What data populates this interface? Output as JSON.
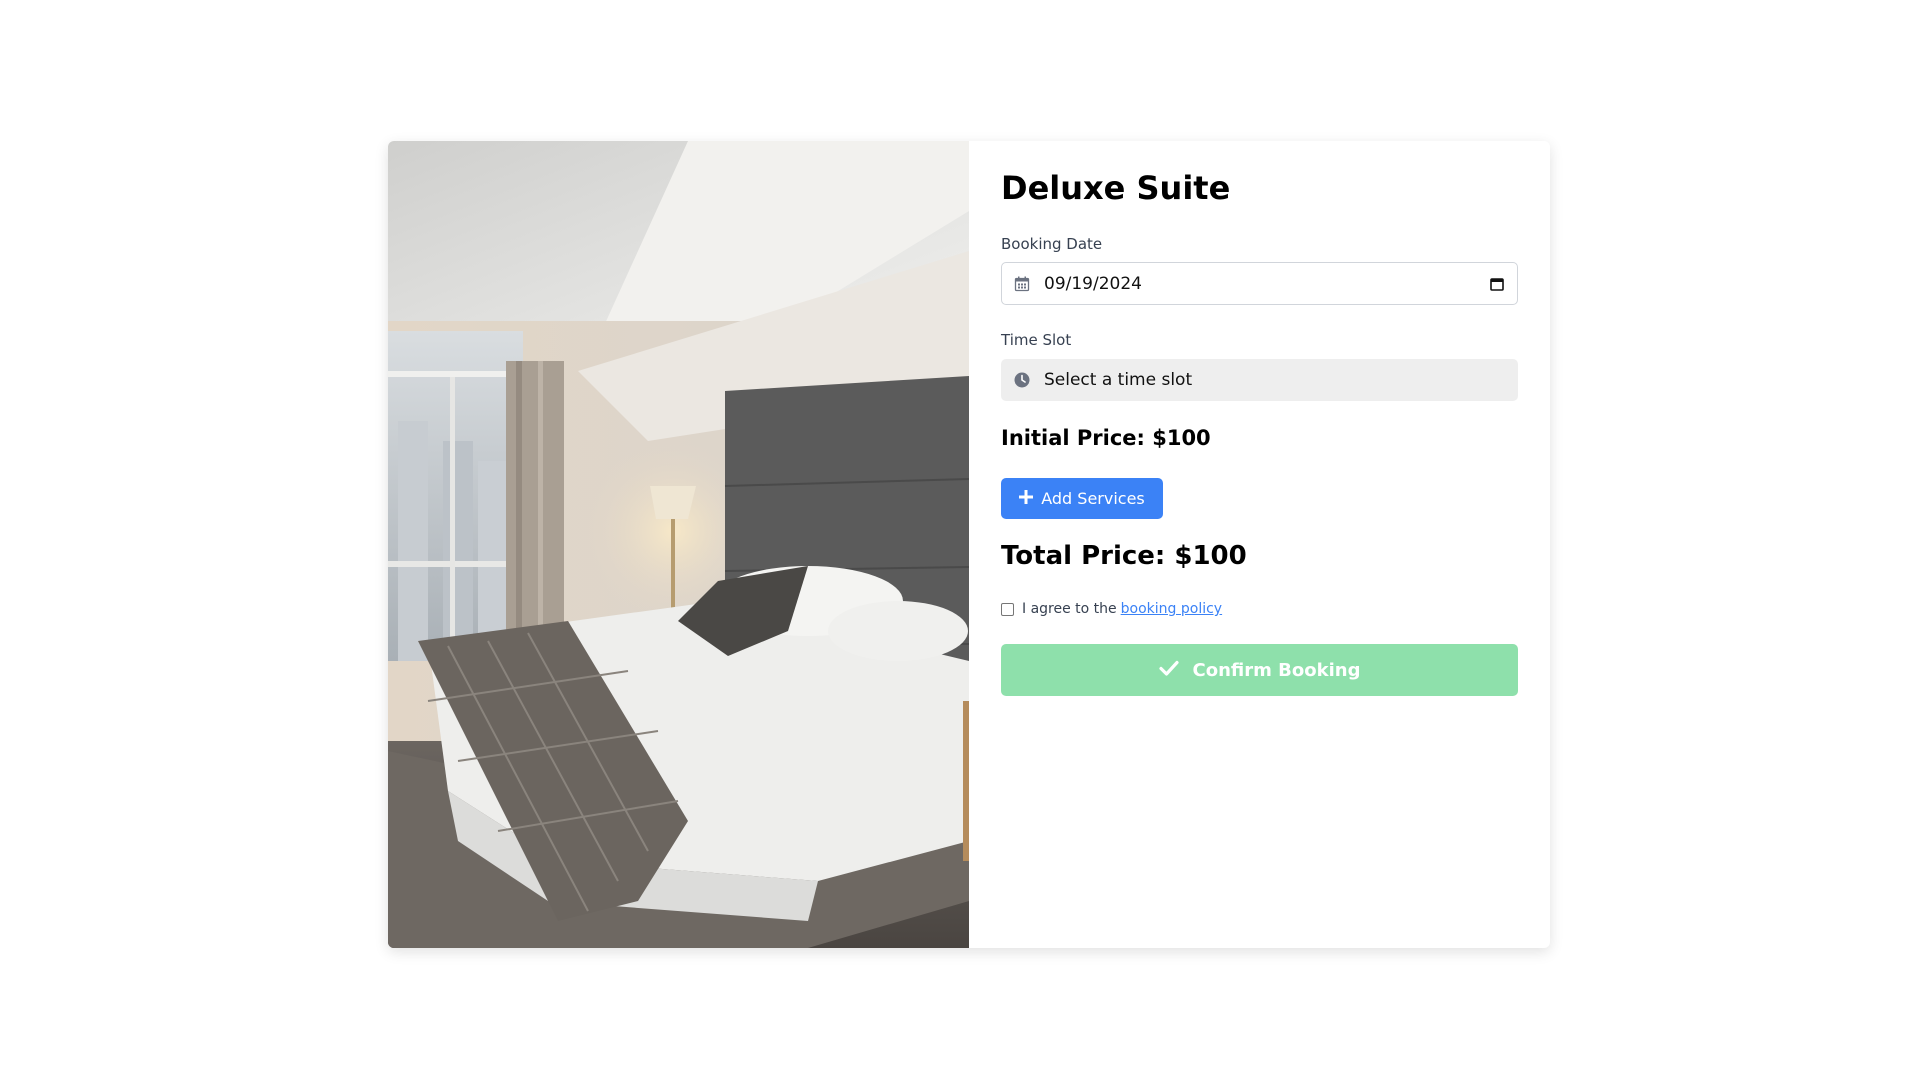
{
  "room": {
    "title": "Deluxe Suite",
    "image_alt": "Hotel room with a bed, gray headboard, bedside lamp and window view"
  },
  "form": {
    "date_label": "Booking Date",
    "date_value": "09/19/2024",
    "time_label": "Time Slot",
    "time_placeholder": "Select a time slot",
    "initial_price": "Initial Price: $100",
    "add_services_label": "Add Services",
    "total_price": "Total Price: $100",
    "agree_text": "I agree to the",
    "agree_link": "booking policy",
    "agree_checked": false,
    "confirm_label": "Confirm Booking"
  },
  "icons": {
    "date": "calendar-icon",
    "date_picker": "calendar-picker-icon",
    "time": "clock-icon",
    "add": "plus-icon",
    "confirm": "check-icon"
  },
  "colors": {
    "primary": "#3b82f6",
    "confirm_disabled": "#8ee0ab",
    "field_border": "#d1d5db",
    "disabled_field": "#eeeeee"
  }
}
